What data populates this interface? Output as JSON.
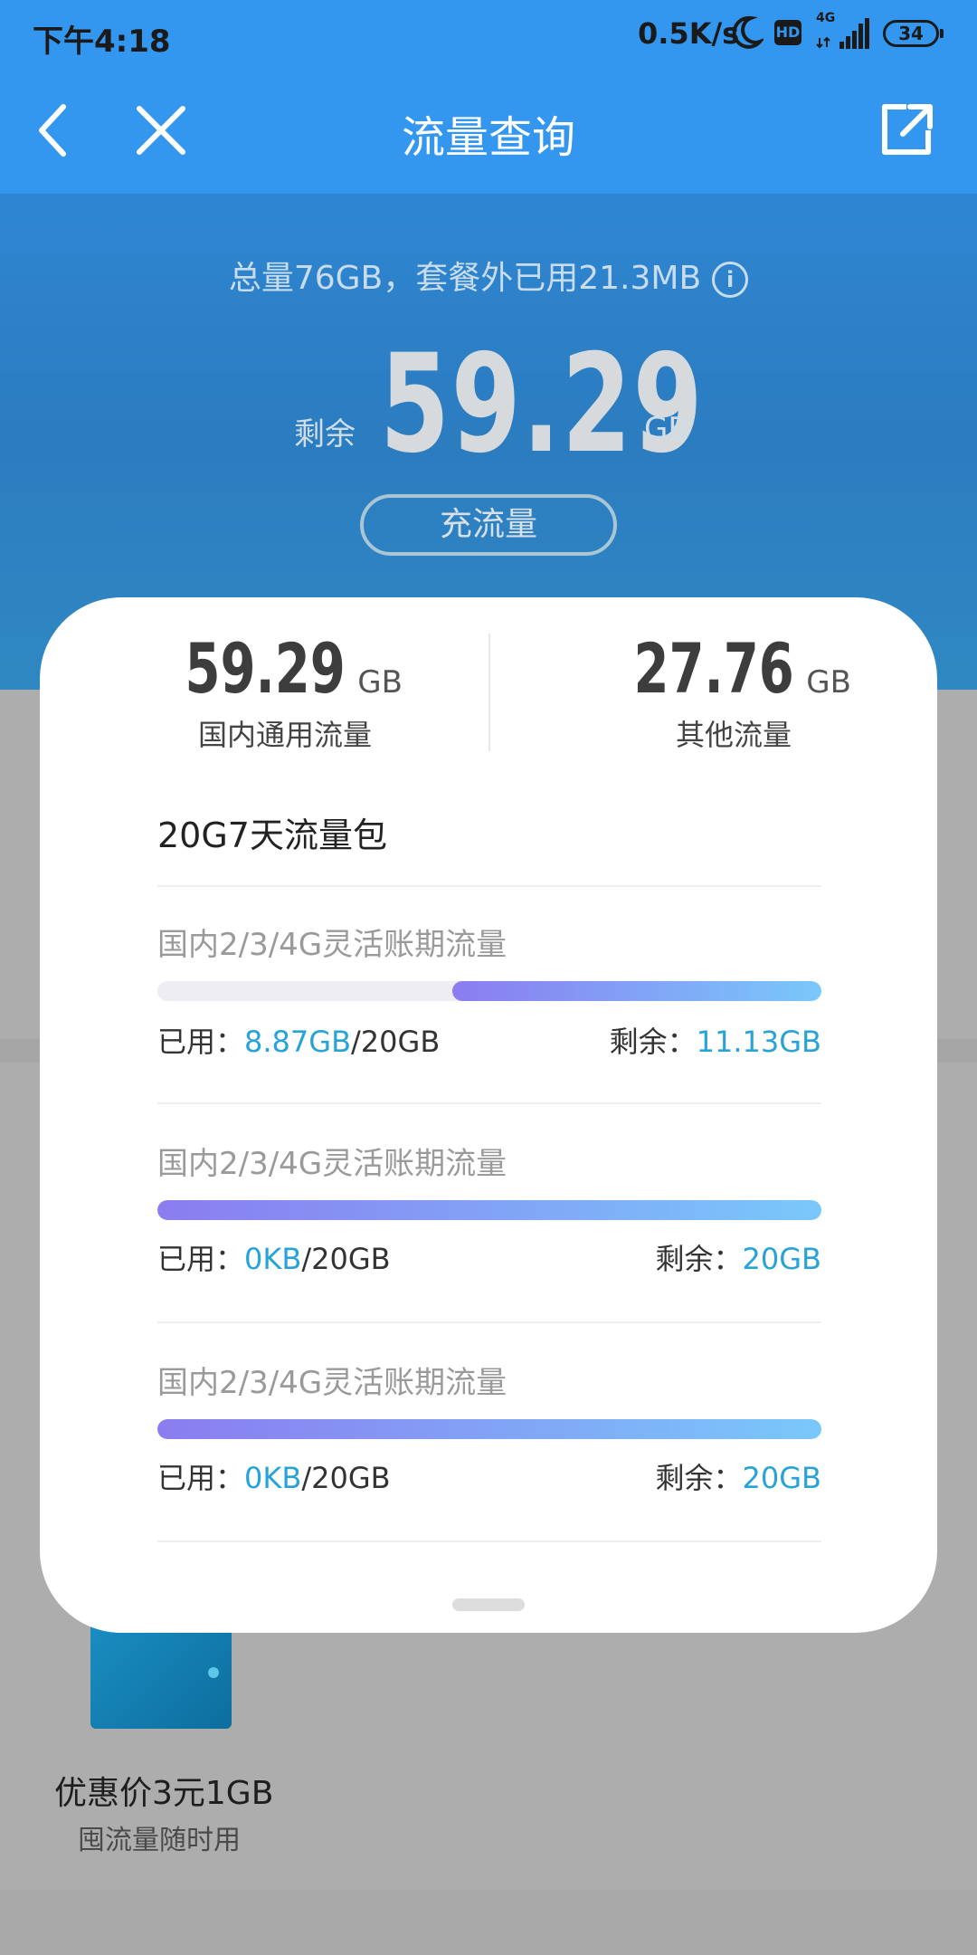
{
  "status_bar": {
    "time": "下午4:18",
    "net_speed": "0.5K/s",
    "hd_badge": "HD",
    "signal_label": "4G",
    "battery": "34",
    "icons": [
      "moon-icon",
      "hd-icon",
      "signal-icon",
      "battery-icon"
    ]
  },
  "nav": {
    "title": "流量查询",
    "icons": [
      "back-icon",
      "close-icon",
      "share-icon"
    ]
  },
  "summary": {
    "text": "总量76GB，套餐外已用21.3MB",
    "info_icon": "i",
    "remain_label": "剩余",
    "remain_value": "59.29",
    "remain_unit": "GB",
    "recharge_label": "充流量"
  },
  "card": {
    "stats": [
      {
        "value": "59.29",
        "unit": "GB",
        "label": "国内通用流量"
      },
      {
        "value": "27.76",
        "unit": "GB",
        "label": "其他流量"
      }
    ],
    "pack_title": "20G7天流量包",
    "rows": [
      {
        "title": "国内2/3/4G灵活账期流量",
        "used_label": "已用：",
        "used": "8.87GB",
        "total": "/20GB",
        "remain_label": "剩余：",
        "remain": "11.13GB",
        "remaining_fraction": 0.5565
      },
      {
        "title": "国内2/3/4G灵活账期流量",
        "used_label": "已用：",
        "used": "0KB",
        "total": "/20GB",
        "remain_label": "剩余：",
        "remain": "20GB",
        "remaining_fraction": 1.0
      },
      {
        "title": "国内2/3/4G灵活账期流量",
        "used_label": "已用：",
        "used": "0KB",
        "total": "/20GB",
        "remain_label": "剩余：",
        "remain": "20GB",
        "remaining_fraction": 1.0
      }
    ]
  },
  "promo": {
    "title": "优惠价3元1GB",
    "subtitle": "囤流量随时用"
  },
  "colors": {
    "header_blue": "#3497ef",
    "accent_value": "#27a3d8",
    "bar_gradient_start": "#8b7cf0",
    "bar_gradient_end": "#79c8fb"
  }
}
